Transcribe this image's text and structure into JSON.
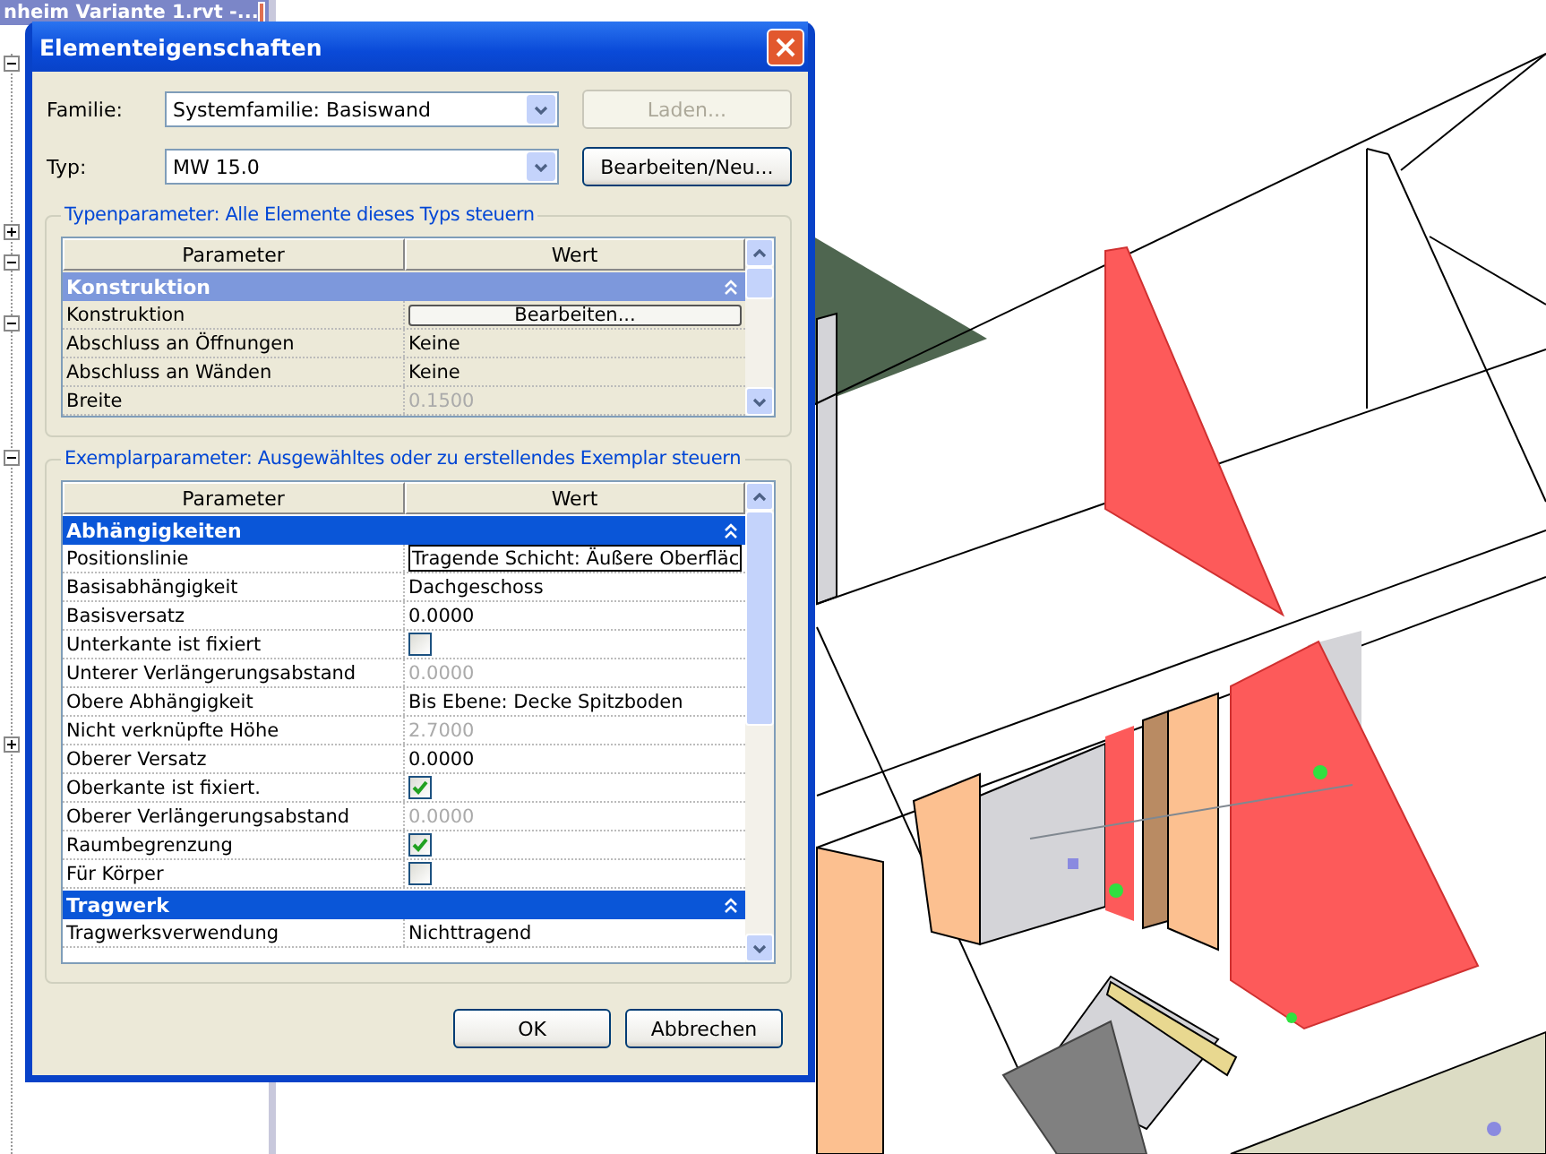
{
  "project_browser": {
    "title": "nheim Variante 1.rvt -...",
    "toggles": [
      {
        "expanded": true
      },
      {
        "expanded": false
      },
      {
        "expanded": true
      },
      {
        "expanded": true
      },
      {
        "expanded": true
      },
      {
        "expanded": false
      }
    ]
  },
  "dialog": {
    "title": "Elementeigenschaften",
    "fields": [
      {
        "label": "Familie:",
        "value": "Systemfamilie: Basiswand",
        "button": "Laden...",
        "button_disabled": true
      },
      {
        "label": "Typ:",
        "value": "MW 15.0",
        "button": "Bearbeiten/Neu...",
        "button_disabled": false
      }
    ],
    "type_parameters": {
      "title": "Typenparameter: Alle Elemente dieses Typs steuern",
      "active": false,
      "columns": [
        "Parameter",
        "Wert"
      ],
      "rows": [
        {
          "kind": "section",
          "name": "Konstruktion"
        },
        {
          "kind": "button",
          "name": "Konstruktion",
          "value": "Bearbeiten..."
        },
        {
          "kind": "text",
          "name": "Abschluss an Öffnungen",
          "value": "Keine",
          "disabled": false
        },
        {
          "kind": "text",
          "name": "Abschluss an Wänden",
          "value": "Keine",
          "disabled": false
        },
        {
          "kind": "text",
          "name": "Breite",
          "value": "0.1500",
          "disabled": true
        }
      ]
    },
    "instance_parameters": {
      "title": "Exemplarparameter: Ausgewähltes oder zu erstellendes Exemplar steuern",
      "active": true,
      "columns": [
        "Parameter",
        "Wert"
      ],
      "rows": [
        {
          "kind": "section",
          "name": "Abhängigkeiten"
        },
        {
          "kind": "dropdown",
          "name": "Positionslinie",
          "value": "Tragende Schicht: Äußere Oberfläc"
        },
        {
          "kind": "text",
          "name": "Basisabhängigkeit",
          "value": "Dachgeschoss",
          "disabled": false
        },
        {
          "kind": "text",
          "name": "Basisversatz",
          "value": "0.0000",
          "disabled": false
        },
        {
          "kind": "checkbox",
          "name": "Unterkante ist fixiert",
          "checked": false
        },
        {
          "kind": "text",
          "name": "Unterer Verlängerungsabstand",
          "value": "0.0000",
          "disabled": true
        },
        {
          "kind": "text",
          "name": "Obere Abhängigkeit",
          "value": "Bis Ebene: Decke Spitzboden",
          "disabled": false
        },
        {
          "kind": "text",
          "name": "Nicht verknüpfte Höhe",
          "value": "2.7000",
          "disabled": true
        },
        {
          "kind": "text",
          "name": "Oberer Versatz",
          "value": "0.0000",
          "disabled": false
        },
        {
          "kind": "checkbox",
          "name": "Oberkante ist fixiert.",
          "checked": true
        },
        {
          "kind": "text",
          "name": "Oberer Verlängerungsabstand",
          "value": "0.0000",
          "disabled": true
        },
        {
          "kind": "checkbox",
          "name": "Raumbegrenzung",
          "checked": true
        },
        {
          "kind": "checkbox",
          "name": "Für Körper",
          "checked": false
        },
        {
          "kind": "section",
          "name": "Tragwerk"
        },
        {
          "kind": "text",
          "name": "Tragwerksverwendung",
          "value": "Nichttragend",
          "disabled": false
        }
      ]
    },
    "buttons": [
      "OK",
      "Abbrechen"
    ]
  }
}
